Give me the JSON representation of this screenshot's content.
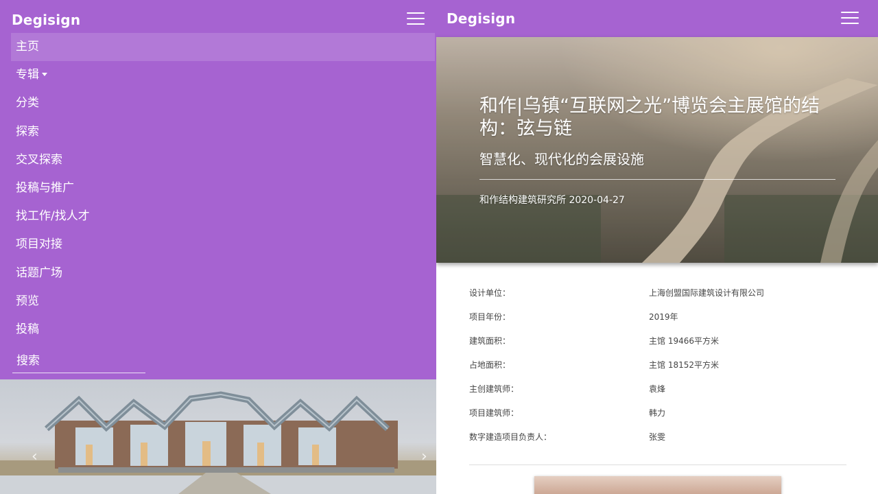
{
  "left_panel": {
    "brand": "Degisign",
    "nav": {
      "items": [
        {
          "label": "主页"
        },
        {
          "label": "专辑"
        },
        {
          "label": "分类"
        },
        {
          "label": "探索"
        },
        {
          "label": "交叉探索"
        },
        {
          "label": "投稿与推广"
        },
        {
          "label": "找工作/找人才"
        },
        {
          "label": "项目对接"
        },
        {
          "label": "话题广场"
        },
        {
          "label": "预览"
        },
        {
          "label": "投稿"
        }
      ],
      "active_index": 0
    },
    "search": {
      "placeholder": "搜索"
    },
    "carousel": {
      "prev_icon": "‹",
      "next_icon": "›"
    }
  },
  "right_panel": {
    "brand": "Degisign",
    "article": {
      "title": "和作|乌镇“互联网之光”博览会主展馆的结构：弦与链",
      "subtitle": "智慧化、现代化的会展设施",
      "meta": "和作结构建筑研究所 2020-04-27"
    },
    "info": [
      {
        "label": "设计单位：",
        "value": "上海创盟国际建筑设计有限公司"
      },
      {
        "label": "项目年份：",
        "value": "2019年"
      },
      {
        "label": "建筑面积：",
        "value": "主馆 19466平方米"
      },
      {
        "label": "占地面积：",
        "value": "主馆 18152平方米"
      },
      {
        "label": "主创建筑师：",
        "value": "袁烽"
      },
      {
        "label": "项目建筑师：",
        "value": "韩力"
      },
      {
        "label": "数字建造项目负责人：",
        "value": "张雯"
      }
    ]
  },
  "colors": {
    "accent": "#a663d1",
    "text": "#ffffff",
    "body_text": "#444444"
  },
  "icons": [
    "hamburger-menu-icon",
    "caret-down-icon",
    "chevron-left-icon",
    "chevron-right-icon"
  ]
}
